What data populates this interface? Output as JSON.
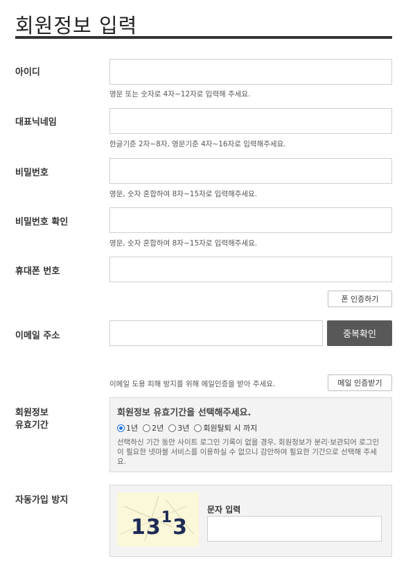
{
  "page": {
    "title": "회원정보 입력"
  },
  "fields": {
    "id": {
      "label": "아이디",
      "value": "",
      "help": "영문 또는 숫자로 4자~12자로 입력해 주세요."
    },
    "nickname": {
      "label": "대표닉네임",
      "value": "",
      "help": "한글기준 2자~8자, 영문기준 4자~16자로 입력해주세요."
    },
    "password": {
      "label": "비밀번호",
      "value": "",
      "help": "영문, 숫자 혼합하여 8자~15자로 입력해주세요."
    },
    "password_confirm": {
      "label": "비밀번호 확인",
      "value": "",
      "help": "영문, 숫자 혼합하여 8자~15자로 입력해주세요."
    },
    "phone": {
      "label": "휴대폰 번호",
      "value": "",
      "verify_button": "폰 인증하기"
    },
    "email": {
      "label": "이메일 주소",
      "value": "",
      "dup_check_button": "중복확인",
      "help": "이메일 도용 피해 방지를 위해 메일인증을 받아 주세요.",
      "verify_button": "메일 인증받기"
    }
  },
  "validity": {
    "label_line1": "회원정보",
    "label_line2": "유효기간",
    "title": "회원정보 유효기간을 선택해주세요.",
    "options": [
      "1년",
      "2년",
      "3년",
      "회원탈퇴 시 까지"
    ],
    "selected": "1년",
    "description": "선택하신 기간 동안 사이트 로그인 기록이 없을 경우, 회원정보가 분리·보관되어 로그인이 필요한 넷마블 서비스를 이용하실 수 없으니 감안하여 필요한 기간으로 선택해 주세요."
  },
  "captcha": {
    "label": "자동가입 방지",
    "image_text_main": "13",
    "image_text_sup": "1",
    "image_text_end": "3",
    "input_label": "문자 입력",
    "input_value": ""
  }
}
